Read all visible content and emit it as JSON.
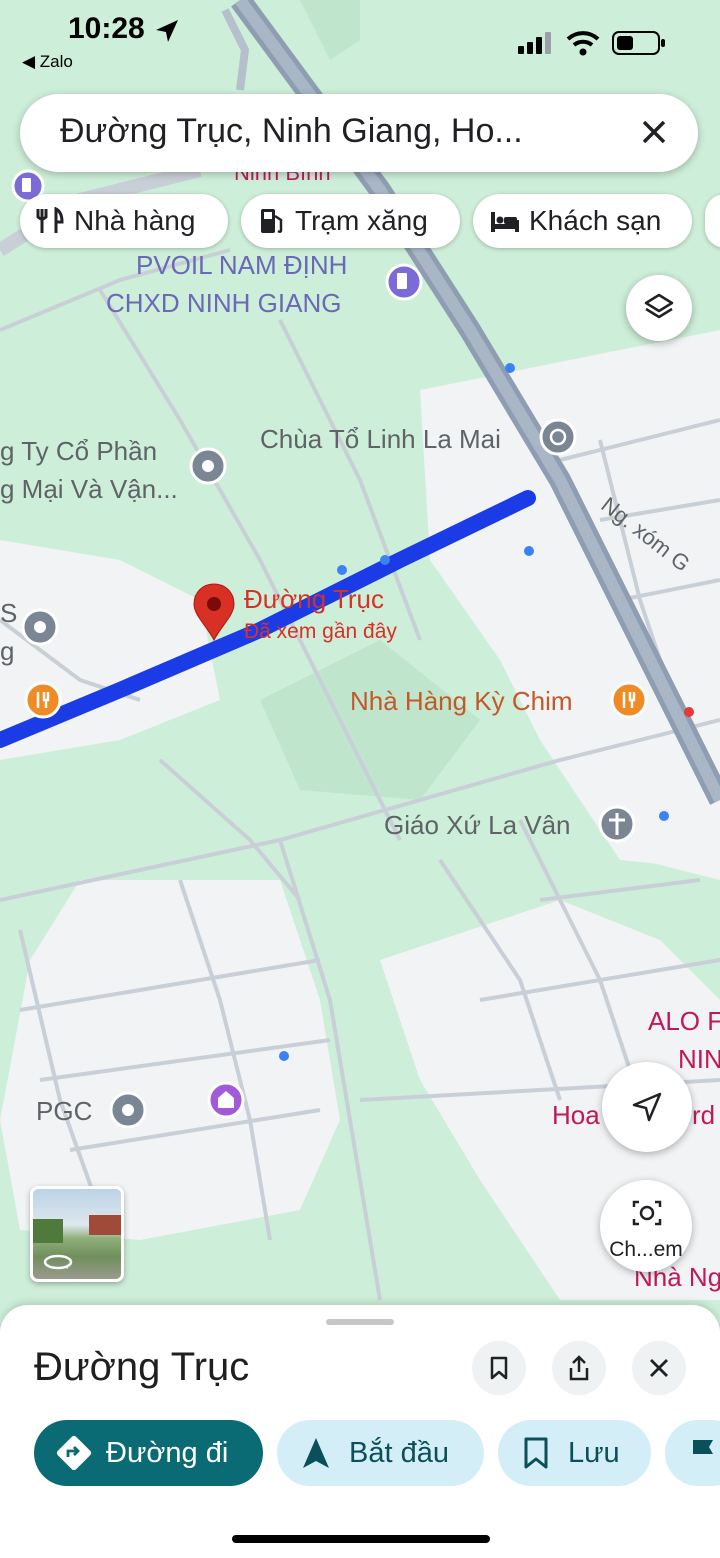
{
  "status_bar": {
    "time": "10:28",
    "back_app": "Zalo"
  },
  "search": {
    "query": "Đường Trục, Ninh Giang, Ho..."
  },
  "category_chips": [
    {
      "label": "Nhà hàng",
      "icon": "restaurant-icon"
    },
    {
      "label": "Trạm xăng",
      "icon": "gas-station-icon"
    },
    {
      "label": "Khách sạn",
      "icon": "hotel-icon"
    }
  ],
  "map": {
    "labels": {
      "top_partial": "Ninh Bình",
      "pvoil_1": "PVOIL NAM ĐỊNH",
      "pvoil_2": "CHXD NINH GIANG",
      "temple": "Chùa Tổ Linh La Mai",
      "company_1": "g Ty Cổ Phần",
      "company_2": "g Mại Và Vận...",
      "edge_s": "S",
      "edge_g": "g",
      "road_label": "Ng. xóm G",
      "pin_title": "Đường Trục",
      "pin_subtitle": "Đã xem gần đây",
      "restaurant": "Nhà Hàng Kỳ Chim",
      "church": "Giáo Xứ La Vân",
      "alo_1": "ALO F",
      "alo_2": "NIN",
      "hoa": "Hoa",
      "hoa_2": "rd",
      "pgc": "PGC",
      "nha_ng": "Nhà Ng"
    },
    "colors": {
      "park": "#cdeed8",
      "urban": "#f1f3f4",
      "road": "#c9cfd6",
      "highway": "#8e9db1",
      "route": "#1a3be6",
      "pin": "#d93025",
      "label_blue": "#6b68b8",
      "label_orange": "#c3592a",
      "label_pink": "#c2185b",
      "label_gray": "#5f6368"
    }
  },
  "controls": {
    "layers_icon": "layers-icon",
    "locate_icon": "navigation-arrow-icon",
    "lens_label": "Ch...em"
  },
  "bottom_sheet": {
    "title": "Đường Trục",
    "actions": [
      {
        "label": "Đường đi",
        "icon": "directions-icon"
      },
      {
        "label": "Bắt đầu",
        "icon": "navigate-arrow-icon"
      },
      {
        "label": "Lưu",
        "icon": "bookmark-icon"
      }
    ]
  }
}
